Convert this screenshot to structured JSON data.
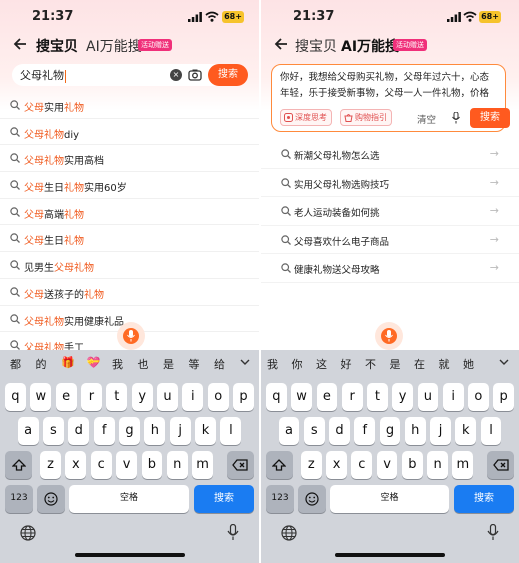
{
  "left": {
    "time": "21:37",
    "battery": "68+",
    "tabs": {
      "search": "搜宝贝",
      "ai": "AI万能搜",
      "ai_badge": "活动赠送"
    },
    "search": {
      "query": "父母礼物",
      "button": "搜索"
    },
    "suggestions": [
      {
        "pre": "",
        "hl": "父母",
        "mid": "实用",
        "hl2": "礼物",
        "post": ""
      },
      {
        "pre": "",
        "hl": "父母礼物",
        "mid": "diy",
        "hl2": "",
        "post": ""
      },
      {
        "pre": "",
        "hl": "父母礼物",
        "mid": "实用高档",
        "hl2": "",
        "post": ""
      },
      {
        "pre": "",
        "hl": "父母",
        "mid": "生日",
        "hl2": "礼物",
        "post": "实用60岁"
      },
      {
        "pre": "",
        "hl": "父母",
        "mid": "高端",
        "hl2": "礼物",
        "post": ""
      },
      {
        "pre": "",
        "hl": "父母",
        "mid": "生日",
        "hl2": "礼物",
        "post": ""
      },
      {
        "pre": "见男生",
        "hl": "父母礼物",
        "mid": "",
        "hl2": "",
        "post": ""
      },
      {
        "pre": "",
        "hl": "父母",
        "mid": "送孩子的",
        "hl2": "礼物",
        "post": ""
      },
      {
        "pre": "",
        "hl": "父母礼物",
        "mid": "实用健康礼品",
        "hl2": "",
        "post": ""
      },
      {
        "pre": "",
        "hl": "父母礼物",
        "mid": "手工",
        "hl2": "",
        "post": ""
      }
    ],
    "candidates": [
      "都",
      "的",
      "🎁",
      "💝",
      "我",
      "也",
      "是",
      "等",
      "给"
    ]
  },
  "right": {
    "time": "21:37",
    "battery": "68+",
    "tabs": {
      "search": "搜宝贝",
      "ai": "AI万能搜",
      "ai_badge": "活动赠送"
    },
    "prompt": "你好，我想给父母购买礼物，父母年过六十，心态年轻，乐于接受新事物，父母一人一件礼物，价格",
    "chips": [
      "深度思考",
      "购物指引"
    ],
    "clear_label": "清空",
    "button": "搜索",
    "suggestions": [
      "新潮父母礼物怎么选",
      "实用父母礼物选购技巧",
      "老人运动装备如何挑",
      "父母喜欢什么电子商品",
      "健康礼物送父母攻略"
    ],
    "candidates": [
      "我",
      "你",
      "这",
      "好",
      "不",
      "是",
      "在",
      "就",
      "她"
    ]
  },
  "keyboard": {
    "row1": [
      "q",
      "w",
      "e",
      "r",
      "t",
      "y",
      "u",
      "i",
      "o",
      "p"
    ],
    "row2": [
      "a",
      "s",
      "d",
      "f",
      "g",
      "h",
      "j",
      "k",
      "l"
    ],
    "row3": [
      "z",
      "x",
      "c",
      "v",
      "b",
      "n",
      "m"
    ],
    "num_key": "123",
    "space": "空格",
    "search": "搜索"
  },
  "colors": {
    "accent": "#ff5a1f",
    "highlight": "#f05a1e",
    "blue_key": "#1a7cf2",
    "badge": "#f0307a"
  }
}
